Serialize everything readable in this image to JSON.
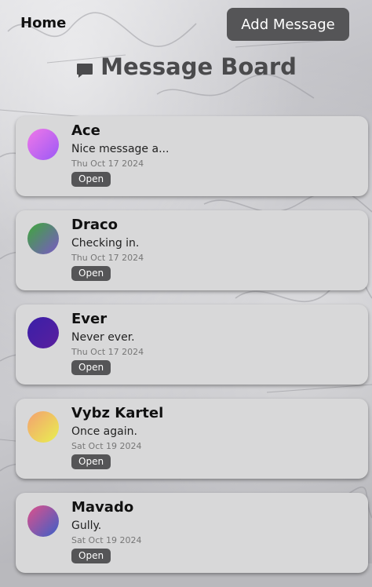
{
  "nav": {
    "home_label": "Home",
    "add_label": "Add Message"
  },
  "page": {
    "title": "Message Board",
    "title_icon": "chat-bubble-icon"
  },
  "messages": [
    {
      "name": "Ace",
      "preview": "Nice message a...",
      "date": "Thu Oct 17 2024",
      "open_label": "Open",
      "avatar_colors": [
        "#f078e8",
        "#9b59f6"
      ]
    },
    {
      "name": "Draco",
      "preview": "Checking in.",
      "date": "Thu Oct 17 2024",
      "open_label": "Open",
      "avatar_colors": [
        "#3ea83a",
        "#7a58c6"
      ]
    },
    {
      "name": "Ever",
      "preview": "Never ever.",
      "date": "Thu Oct 17 2024",
      "open_label": "Open",
      "avatar_colors": [
        "#3a1fa8",
        "#5a1f9e"
      ]
    },
    {
      "name": "Vybz Kartel",
      "preview": "Once again.",
      "date": "Sat Oct 19 2024",
      "open_label": "Open",
      "avatar_colors": [
        "#f4a070",
        "#e8f050"
      ]
    },
    {
      "name": "Mavado",
      "preview": "Gully.",
      "date": "Sat Oct 19 2024",
      "open_label": "Open",
      "avatar_colors": [
        "#e0508a",
        "#3a60c8"
      ]
    }
  ],
  "colors": {
    "button_bg": "#555557",
    "card_bg": "#d8d8d9",
    "title_color": "#4a4a4c"
  }
}
